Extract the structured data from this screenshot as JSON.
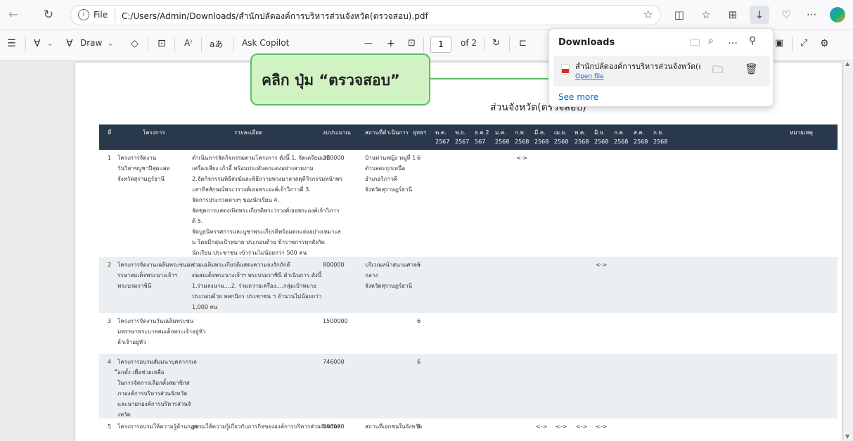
{
  "browser": {
    "url_prefix": "File",
    "url": "C:/Users/Admin/Downloads/สำนักปลัดองค์การบริหารส่วนจังหวัด(ตรวจสอบ).pdf",
    "more_label": "···"
  },
  "pdf_toolbar": {
    "draw_label": "Draw",
    "read_aloud_label": "A⁾",
    "translate_label": "aあ",
    "ask_copilot_label": "Ask Copilot",
    "zoom_out": "—",
    "zoom_in": "+",
    "page_number": "1",
    "page_total": "of 2"
  },
  "downloads": {
    "title": "Downloads",
    "file_name": "สำนักปลัดองค์การบริหารส่วนจังหวัด(ตรวจส",
    "open_file": "Open file",
    "see_more": "See more"
  },
  "callout": {
    "text": "คลิก ปุ่ม “ตรวจสอบ”"
  },
  "document": {
    "title": "ส่วนจังหวัด(ตรวจสอบ)",
    "headers": {
      "no": "ที่",
      "project": "โครงการ",
      "details": "รายละเอียด",
      "budget": "งบประมาณ",
      "location": "สถานที่ดำเนินการ",
      "strategy": "ยุทธฯ",
      "remark": "หมายเหตุ"
    },
    "months": [
      {
        "m": "ต.ค.",
        "y": "2567"
      },
      {
        "m": "พ.ย.",
        "y": "2567"
      },
      {
        "m": "ธ.ค.2",
        "y": "567"
      },
      {
        "m": "ม.ค.",
        "y": "2568"
      },
      {
        "m": "ก.พ.",
        "y": "2568"
      },
      {
        "m": "มี.ค.",
        "y": "2568"
      },
      {
        "m": "เม.ย.",
        "y": "2568"
      },
      {
        "m": "พ.ค.",
        "y": "2568"
      },
      {
        "m": "มิ.ย.",
        "y": "2568"
      },
      {
        "m": "ก.ค.",
        "y": "2568"
      },
      {
        "m": "ส.ค.",
        "y": "2568"
      },
      {
        "m": "ก.ย.",
        "y": "2568"
      }
    ],
    "rows": [
      {
        "no": "1",
        "project": [
          "โครงการจัดงาน",
          "วันวิสาขบูชาปีสุดแสด",
          "จังหวัดสุราษฎร์ธานี"
        ],
        "details": [
          "ดำเนินการจัดกิจกรรมตามโครงการ ดังนี้ 1. จัดเตรียมเวที",
          "เครื่องเสียง เก้าอี้ พร้อมประดับตกแต่งอย่างสวยงาม",
          "2.จัดกิจกรรมพิธีสงฆ์และพิธีถวายพวงมาลาสดุดีวีรกรรมหน้าพร",
          "ะสาทิสลักษณ์พระวรวงศ์เธอพระองค์เจ้าวิภาวดี 3.",
          "จัดการประกวดต่างๆ ของนักเรียน 4.",
          "จัดชุดการแสดงเทิดพระเกียรติพระวรวงศ์เธอพระองค์เจ้าวิภาว",
          "ดี 5.",
          "จัดบูธนิทรรศการและบูชาพระเกียรติพร้อมตกแต่งอย่างเหมาะส",
          "ม โดยมีกลุ่มเป้าหมาย ประกอบด้วย ข้าราชการทุกสังกัด",
          "นักเรียน ประชาชน เข้าร่วมไม่น้อยกว่า 500 คน"
        ],
        "budget": "200000",
        "location": [
          "บ้านท่านหญิง หมู่ที่ 1",
          "ตำบลตะกุกเหนือ",
          "อำเภอวิภาวดี",
          "จังหวัดสุราษฎร์ธานี"
        ],
        "strategy": "6",
        "marks": [
          "",
          "",
          "",
          "",
          "<->",
          "",
          "",
          "",
          "",
          "",
          "",
          ""
        ]
      },
      {
        "no": "2",
        "project": [
          "โครงการจัดงานเฉลิมพระชนมพ",
          "รรษาสมเด็จพระนางเจ้าฯ",
          "พระบรมราชินี"
        ],
        "details": [
          "ร่วมเฉลิมพระเกียรติแสดงความจงรักภักดี",
          "ต่อสมเด็จพระนางเจ้าฯ พระบรมราชินี ดำเนินการ ดังนี้",
          "1.ร่วมลงนาม....2. ร่วมถวายเครื่อง....กลุ่มเป้าหมาย",
          "ประกอบด้วย พสกนิกร ประชาชน ฯ จำนวนไม่น้อยกว่า",
          "1,000 คน"
        ],
        "budget": "800000",
        "location": [
          "บริเวณหน้าสนามศาลา",
          "กลาง",
          "จังหวัดสุราษฎร์ธานี"
        ],
        "strategy": "6",
        "marks": [
          "",
          "",
          "",
          "",
          "",
          "",
          "",
          "",
          "<->",
          "",
          "",
          ""
        ]
      },
      {
        "no": "3",
        "project": [
          "โครงการจัดงานวันเฉลิมพระชน",
          "มพรรษาพระบาทสมเด็จพระเจ้าอยู่หัว",
          "ล้าเจ้าอยู่หัว"
        ],
        "details": [],
        "budget": "1500000",
        "location": [],
        "strategy": "6",
        "marks": [
          "",
          "",
          "",
          "",
          "",
          "",
          "",
          "",
          "",
          "",
          "",
          ""
        ]
      },
      {
        "no": "4",
        "project": [
          "โครงการอบรมสัมมนาบุคลากรเล",
          "ือกตั้ง เพื่อช่วยเหลือ",
          "ในการจัดการเลือกตั้งสมาชิกส",
          "ภาองค์การบริหารส่วนจังหวัด",
          "และนายกองค์การบริหารส่วนจั",
          "งหวัด"
        ],
        "details": [],
        "budget": "746000",
        "location": [],
        "strategy": "6",
        "marks": [
          "",
          "",
          "",
          "",
          "",
          "",
          "",
          "",
          "",
          "",
          "",
          ""
        ]
      },
      {
        "no": "5",
        "project": [
          "โครงการอบรมให้ความรู้ด้านกฎห"
        ],
        "details": [
          "อบรมให้ความรู้เกี่ยวกับภารกิจขององค์การบริหารส่วนจังหวัดส"
        ],
        "budget": "500000",
        "location": [
          "สถานที่เอกชนในจังหวัด"
        ],
        "strategy": "6",
        "marks": [
          "",
          "",
          "",
          "",
          "",
          "<->",
          "<->",
          "<->",
          "<->",
          "",
          "",
          ""
        ]
      }
    ]
  }
}
